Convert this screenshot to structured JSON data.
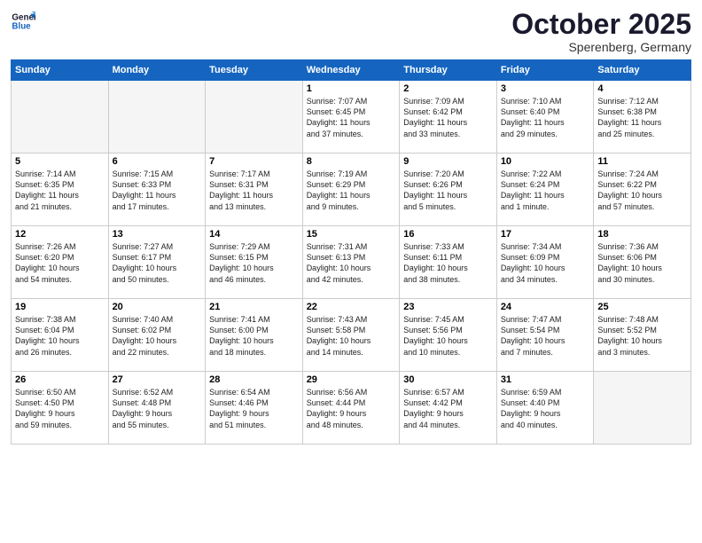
{
  "header": {
    "logo_line1": "General",
    "logo_line2": "Blue",
    "month": "October 2025",
    "location": "Sperenberg, Germany"
  },
  "weekdays": [
    "Sunday",
    "Monday",
    "Tuesday",
    "Wednesday",
    "Thursday",
    "Friday",
    "Saturday"
  ],
  "weeks": [
    [
      {
        "day": "",
        "detail": ""
      },
      {
        "day": "",
        "detail": ""
      },
      {
        "day": "",
        "detail": ""
      },
      {
        "day": "1",
        "detail": "Sunrise: 7:07 AM\nSunset: 6:45 PM\nDaylight: 11 hours\nand 37 minutes."
      },
      {
        "day": "2",
        "detail": "Sunrise: 7:09 AM\nSunset: 6:42 PM\nDaylight: 11 hours\nand 33 minutes."
      },
      {
        "day": "3",
        "detail": "Sunrise: 7:10 AM\nSunset: 6:40 PM\nDaylight: 11 hours\nand 29 minutes."
      },
      {
        "day": "4",
        "detail": "Sunrise: 7:12 AM\nSunset: 6:38 PM\nDaylight: 11 hours\nand 25 minutes."
      }
    ],
    [
      {
        "day": "5",
        "detail": "Sunrise: 7:14 AM\nSunset: 6:35 PM\nDaylight: 11 hours\nand 21 minutes."
      },
      {
        "day": "6",
        "detail": "Sunrise: 7:15 AM\nSunset: 6:33 PM\nDaylight: 11 hours\nand 17 minutes."
      },
      {
        "day": "7",
        "detail": "Sunrise: 7:17 AM\nSunset: 6:31 PM\nDaylight: 11 hours\nand 13 minutes."
      },
      {
        "day": "8",
        "detail": "Sunrise: 7:19 AM\nSunset: 6:29 PM\nDaylight: 11 hours\nand 9 minutes."
      },
      {
        "day": "9",
        "detail": "Sunrise: 7:20 AM\nSunset: 6:26 PM\nDaylight: 11 hours\nand 5 minutes."
      },
      {
        "day": "10",
        "detail": "Sunrise: 7:22 AM\nSunset: 6:24 PM\nDaylight: 11 hours\nand 1 minute."
      },
      {
        "day": "11",
        "detail": "Sunrise: 7:24 AM\nSunset: 6:22 PM\nDaylight: 10 hours\nand 57 minutes."
      }
    ],
    [
      {
        "day": "12",
        "detail": "Sunrise: 7:26 AM\nSunset: 6:20 PM\nDaylight: 10 hours\nand 54 minutes."
      },
      {
        "day": "13",
        "detail": "Sunrise: 7:27 AM\nSunset: 6:17 PM\nDaylight: 10 hours\nand 50 minutes."
      },
      {
        "day": "14",
        "detail": "Sunrise: 7:29 AM\nSunset: 6:15 PM\nDaylight: 10 hours\nand 46 minutes."
      },
      {
        "day": "15",
        "detail": "Sunrise: 7:31 AM\nSunset: 6:13 PM\nDaylight: 10 hours\nand 42 minutes."
      },
      {
        "day": "16",
        "detail": "Sunrise: 7:33 AM\nSunset: 6:11 PM\nDaylight: 10 hours\nand 38 minutes."
      },
      {
        "day": "17",
        "detail": "Sunrise: 7:34 AM\nSunset: 6:09 PM\nDaylight: 10 hours\nand 34 minutes."
      },
      {
        "day": "18",
        "detail": "Sunrise: 7:36 AM\nSunset: 6:06 PM\nDaylight: 10 hours\nand 30 minutes."
      }
    ],
    [
      {
        "day": "19",
        "detail": "Sunrise: 7:38 AM\nSunset: 6:04 PM\nDaylight: 10 hours\nand 26 minutes."
      },
      {
        "day": "20",
        "detail": "Sunrise: 7:40 AM\nSunset: 6:02 PM\nDaylight: 10 hours\nand 22 minutes."
      },
      {
        "day": "21",
        "detail": "Sunrise: 7:41 AM\nSunset: 6:00 PM\nDaylight: 10 hours\nand 18 minutes."
      },
      {
        "day": "22",
        "detail": "Sunrise: 7:43 AM\nSunset: 5:58 PM\nDaylight: 10 hours\nand 14 minutes."
      },
      {
        "day": "23",
        "detail": "Sunrise: 7:45 AM\nSunset: 5:56 PM\nDaylight: 10 hours\nand 10 minutes."
      },
      {
        "day": "24",
        "detail": "Sunrise: 7:47 AM\nSunset: 5:54 PM\nDaylight: 10 hours\nand 7 minutes."
      },
      {
        "day": "25",
        "detail": "Sunrise: 7:48 AM\nSunset: 5:52 PM\nDaylight: 10 hours\nand 3 minutes."
      }
    ],
    [
      {
        "day": "26",
        "detail": "Sunrise: 6:50 AM\nSunset: 4:50 PM\nDaylight: 9 hours\nand 59 minutes."
      },
      {
        "day": "27",
        "detail": "Sunrise: 6:52 AM\nSunset: 4:48 PM\nDaylight: 9 hours\nand 55 minutes."
      },
      {
        "day": "28",
        "detail": "Sunrise: 6:54 AM\nSunset: 4:46 PM\nDaylight: 9 hours\nand 51 minutes."
      },
      {
        "day": "29",
        "detail": "Sunrise: 6:56 AM\nSunset: 4:44 PM\nDaylight: 9 hours\nand 48 minutes."
      },
      {
        "day": "30",
        "detail": "Sunrise: 6:57 AM\nSunset: 4:42 PM\nDaylight: 9 hours\nand 44 minutes."
      },
      {
        "day": "31",
        "detail": "Sunrise: 6:59 AM\nSunset: 4:40 PM\nDaylight: 9 hours\nand 40 minutes."
      },
      {
        "day": "",
        "detail": ""
      }
    ]
  ]
}
